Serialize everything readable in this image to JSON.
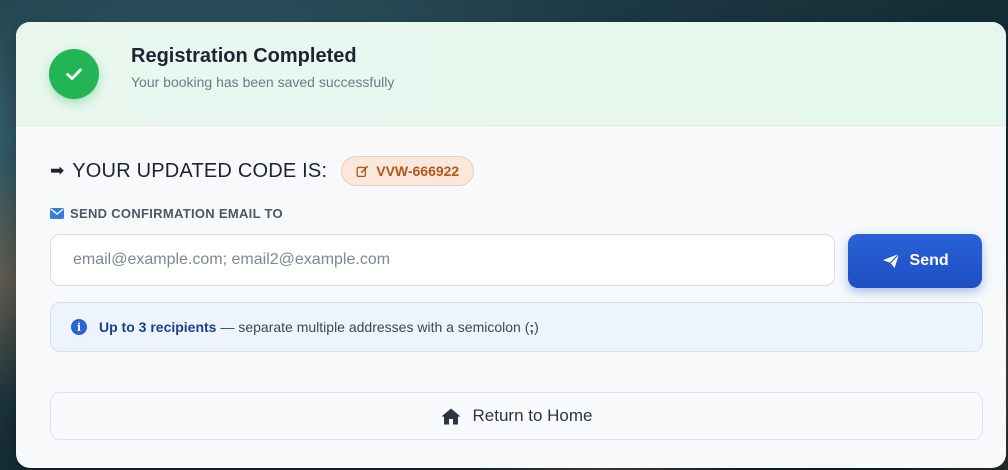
{
  "header": {
    "title": "Registration Completed",
    "subtitle": "Your booking has been saved successfully",
    "icon": "check-icon"
  },
  "code": {
    "arrow": "➡",
    "label": "YOUR UPDATED CODE IS:",
    "value": "VVW-666922",
    "icon": "edit-icon"
  },
  "email": {
    "heading": "SEND CONFIRMATION EMAIL TO",
    "heading_icon": "envelope-icon",
    "placeholder": "email@example.com; email2@example.com",
    "value": "",
    "send_label": "Send",
    "send_icon": "paper-plane-icon"
  },
  "info": {
    "strong": "Up to 3 recipients",
    "rest": "— separate multiple addresses with a semicolon (",
    "semicolon": ";",
    "close": ")"
  },
  "home": {
    "label": "Return to Home",
    "icon": "home-icon"
  },
  "colors": {
    "success": "#22b455",
    "primary": "#1e4fc2",
    "code_text": "#b4551b",
    "code_bg": "#fbe8dc"
  }
}
